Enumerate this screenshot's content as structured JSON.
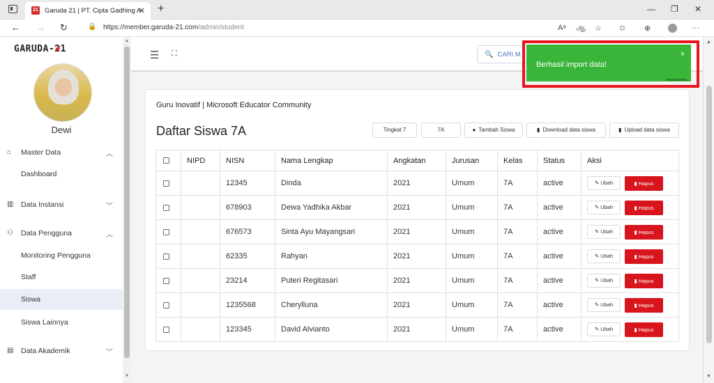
{
  "browser": {
    "tab_title": "Garuda 21 | PT. Cipta Gadhing A",
    "favicon_text": "21",
    "url_host": "https://member.garuda-21.com",
    "url_path": "/admin/student",
    "reader_label": "Aᵃ",
    "translate_label": "ஆ"
  },
  "sidebar": {
    "logo": "GARUDA-21",
    "user_name": "Dewi",
    "items": [
      {
        "label": "Master Data",
        "icon": "home-icon",
        "chevron": "^"
      },
      {
        "label": "Dashboard"
      },
      {
        "label": "Data Instansi",
        "icon": "building-icon",
        "chevron": "v"
      },
      {
        "label": "Data Pengguna",
        "icon": "user-icon",
        "chevron": "^"
      },
      {
        "label": "Monitoring Pengguna"
      },
      {
        "label": "Staff"
      },
      {
        "label": "Siswa"
      },
      {
        "label": "Siswa Lainnya"
      },
      {
        "label": "Data Akademik",
        "icon": "book-icon",
        "chevron": "v"
      }
    ]
  },
  "topbar": {
    "search_label": "CARI M"
  },
  "toast": {
    "message": "Berhasil import data!",
    "close": "×",
    "color": "#39b53a"
  },
  "card": {
    "org": "Guru Inovatif | Microsoft Educator Community",
    "title": "Daftar Siswa 7A",
    "chips": {
      "tingkat": "Tingkat 7",
      "kelas": "7A",
      "tambah": "Tambah Siswa",
      "download": "Download data siswa",
      "upload": "Upload data siswa"
    }
  },
  "table": {
    "headers": [
      "NIPD",
      "NISN",
      "Nama Lengkap",
      "Angkatan",
      "Jurusan",
      "Kelas",
      "Status",
      "Aksi"
    ],
    "edit_label": "Ubah",
    "delete_label": "Hapus",
    "rows": [
      {
        "nipd": "",
        "nisn": "12345",
        "nama": "Dinda",
        "angkatan": "2021",
        "jurusan": "Umum",
        "kelas": "7A",
        "status": "active"
      },
      {
        "nipd": "",
        "nisn": "678903",
        "nama": "Dewa Yadhika Akbar",
        "angkatan": "2021",
        "jurusan": "Umum",
        "kelas": "7A",
        "status": "active"
      },
      {
        "nipd": "",
        "nisn": "676573",
        "nama": "Sinta Ayu Mayangsari",
        "angkatan": "2021",
        "jurusan": "Umum",
        "kelas": "7A",
        "status": "active"
      },
      {
        "nipd": "",
        "nisn": "62335",
        "nama": "Rahyan",
        "angkatan": "2021",
        "jurusan": "Umum",
        "kelas": "7A",
        "status": "active"
      },
      {
        "nipd": "",
        "nisn": "23214",
        "nama": "Puteri Regitasari",
        "angkatan": "2021",
        "jurusan": "Umum",
        "kelas": "7A",
        "status": "active"
      },
      {
        "nipd": "",
        "nisn": "1235568",
        "nama": "Cherylluna",
        "angkatan": "2021",
        "jurusan": "Umum",
        "kelas": "7A",
        "status": "active"
      },
      {
        "nipd": "",
        "nisn": "123345",
        "nama": "David Alvianto",
        "angkatan": "2021",
        "jurusan": "Umum",
        "kelas": "7A",
        "status": "active"
      }
    ]
  }
}
